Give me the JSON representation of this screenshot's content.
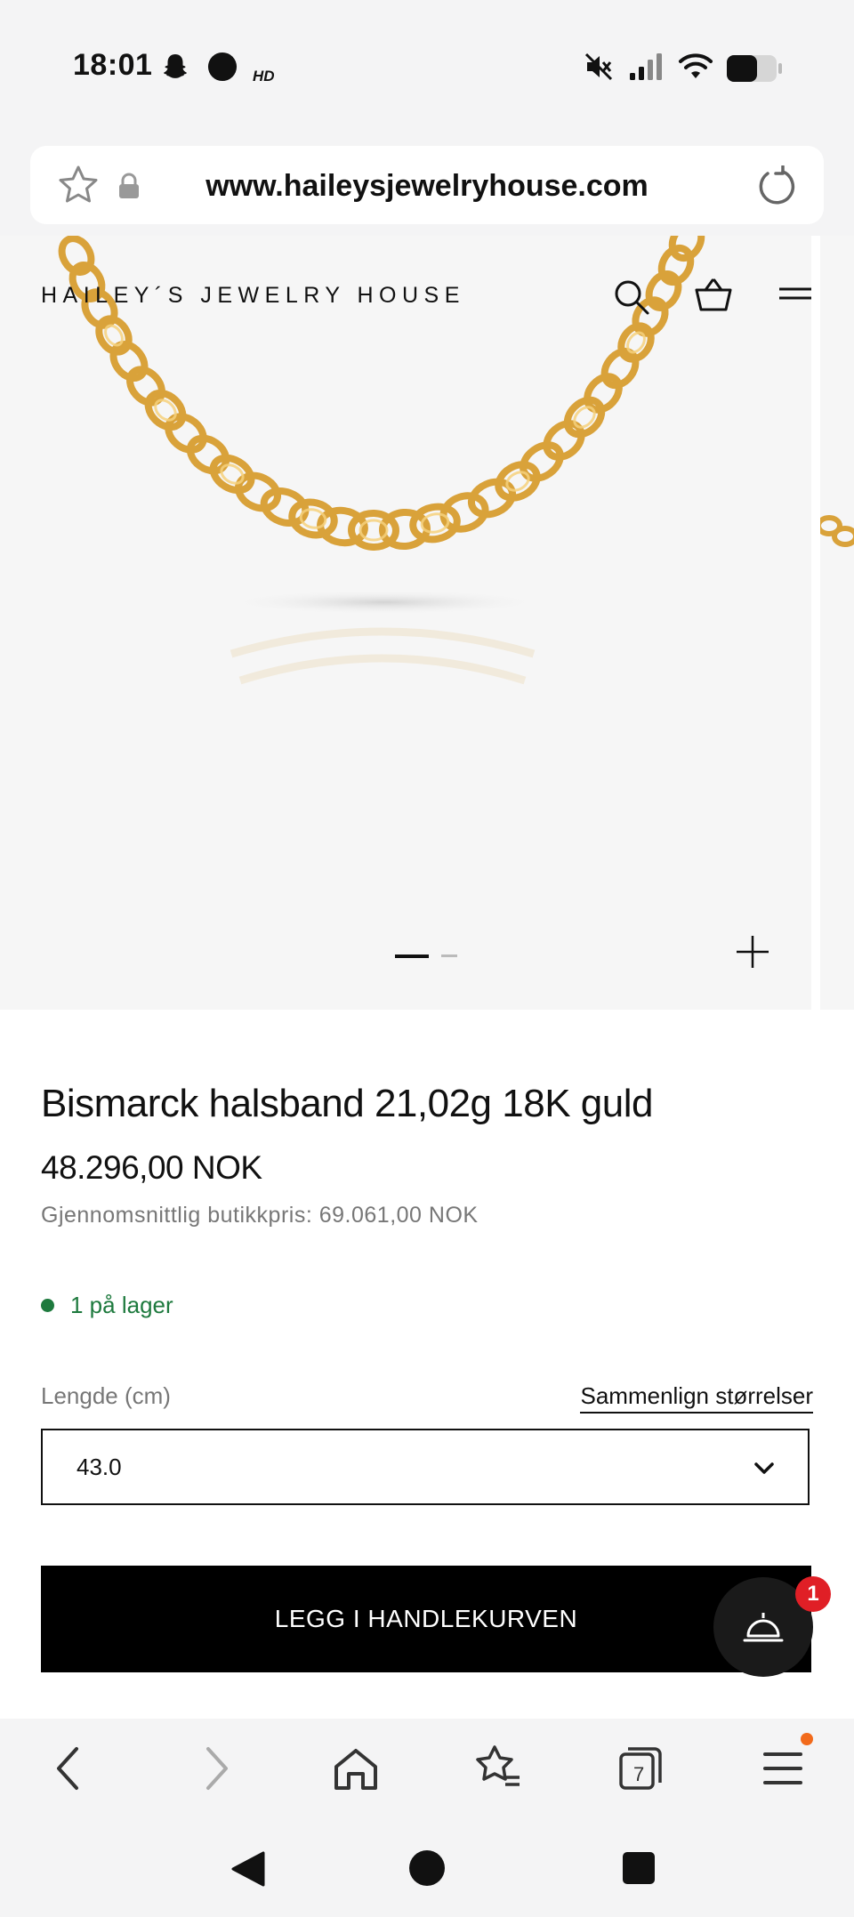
{
  "status_bar": {
    "time": "18:01",
    "left_icons": [
      "snapchat-icon",
      "circle-icon",
      "hd-icon"
    ],
    "right_icons": [
      "mute-icon",
      "signal-icon",
      "wifi-icon",
      "battery-icon"
    ]
  },
  "browser": {
    "url": "www.haileysjewelryhouse.com",
    "tabs_count": "7"
  },
  "site": {
    "brand": "HAILEY´S JEWELRY HOUSE"
  },
  "product": {
    "title": "Bismarck halsband 21,02g 18K guld",
    "price": "48.296,00 NOK",
    "avg_price": "Gjennomsnittlig butikkpris: 69.061,00 NOK",
    "stock": "1 på lager",
    "length_label": "Lengde (cm)",
    "compare_sizes": "Sammenlign størrelser",
    "length_value": "43.0",
    "add_to_cart": "LEGG I HANDLEKURVEN",
    "gallery_slides": 2,
    "gallery_active": 1
  },
  "chat": {
    "badge": "1"
  },
  "colors": {
    "stock_green": "#1e7a3e",
    "badge_red": "#e01f26",
    "gold": "#e2b04a",
    "notification_orange": "#f26a1b"
  }
}
